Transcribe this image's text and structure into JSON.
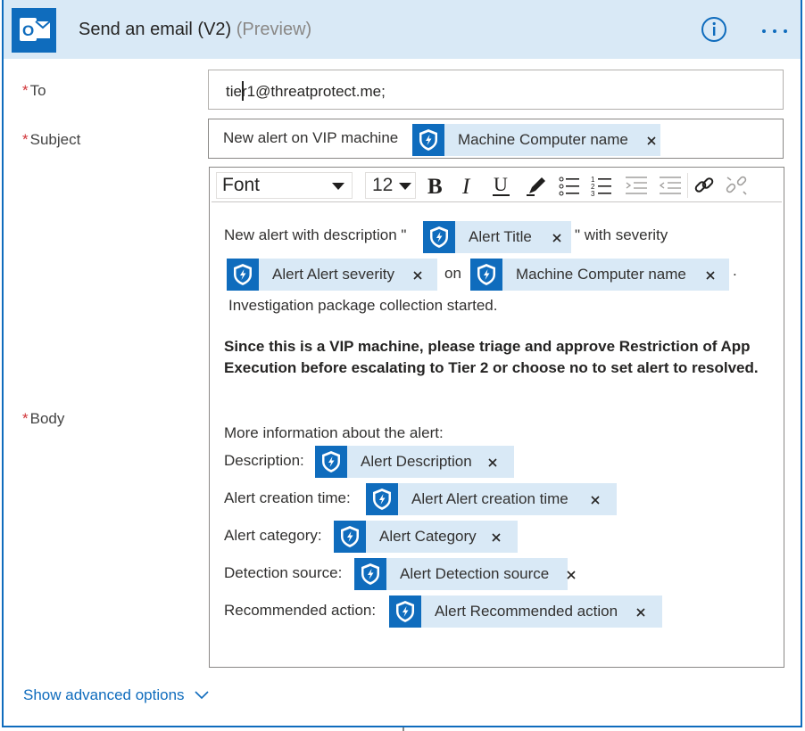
{
  "action": {
    "title": "Send an email (V2)",
    "preview_tag": "(Preview)"
  },
  "fields": {
    "required_mark": "*",
    "to": {
      "label": "To",
      "value": "tier1@threatprotect.me;"
    },
    "subject": {
      "label": "Subject",
      "text": "New alert on VIP machine",
      "token": "Machine Computer name"
    },
    "body": {
      "label": "Body"
    }
  },
  "toolbar": {
    "font": "Font",
    "font_size": "12",
    "icons": [
      "bold-icon",
      "italic-icon",
      "underline-icon",
      "highlight-icon",
      "bulleted-list-icon",
      "numbered-list-icon",
      "decrease-indent-icon",
      "increase-indent-icon",
      "link-icon",
      "unlink-icon"
    ]
  },
  "body": {
    "line1_prefix": "New alert with description \"",
    "token_alert_title": "Alert Title",
    "line1_mid": "\" with severity",
    "token_alert_severity": "Alert Alert severity",
    "on_text": "on",
    "token_machine_name": "Machine Computer name",
    "period": ".",
    "line3": "Investigation package collection started.",
    "bold_paragraph": "Since this is a VIP machine, please triage  and approve Restriction of App Execution before escalating to Tier 2 or choose no to set alert to resolved.",
    "more_info": "More information about the alert:",
    "rows": [
      {
        "label": "Description:",
        "token": "Alert Description"
      },
      {
        "label": "Alert creation time:",
        "token": "Alert Alert creation time"
      },
      {
        "label": "Alert category:",
        "token": "Alert Category"
      },
      {
        "label": "Detection source:",
        "token": "Alert Detection source"
      },
      {
        "label": "Recommended action:",
        "token": "Alert Recommended action"
      }
    ]
  },
  "footer": {
    "advanced_options": "Show advanced options"
  },
  "colors": {
    "accent": "#0f6cbd",
    "header_bg": "#d9e9f6",
    "token_bg": "#d9e9f6",
    "required": "#d13438"
  }
}
